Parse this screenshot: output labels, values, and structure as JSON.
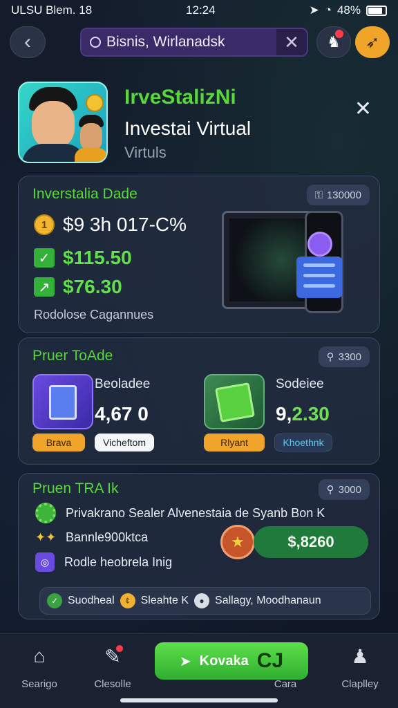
{
  "status_bar": {
    "carrier": "ULSU Blem. 18",
    "time": "12:24",
    "battery": "48%"
  },
  "topbar": {
    "search_tag": "Bisnis, Wirlanadsk",
    "clear_symbol": "✕",
    "back_symbol": "‹"
  },
  "hero": {
    "title": "IrveStalizNi",
    "subtitle": "Investai Virtual",
    "caption": "Virtuls"
  },
  "card1": {
    "title": "Inverstalia Dade",
    "pill": "130000",
    "row_coin_value": "$9 3h 017-C%",
    "row_green1_prefix": "$",
    "row_green1_value": "$115.50",
    "row_green2_value": "$76.30",
    "footer": "Rodolose Cagannues"
  },
  "card2": {
    "title": "Pruer ToAde",
    "pill": "3300",
    "left": {
      "label": "Beoladee",
      "value": "4,67 0",
      "chip1": "Brava",
      "chip2": "Vicheftom"
    },
    "right": {
      "label": "Sodeiee",
      "value_white": "9,",
      "value_green": "2.30",
      "chip1": "Rlyant",
      "chip2": "Khoethnk"
    }
  },
  "card3": {
    "title": "Pruen TRA Ik",
    "pill": "3000",
    "line1": "Privakrano Sealer Alvenestaia de Syanb Bon K",
    "line2": "Bannle900ktca",
    "line3": "Rodle heobrela Inig",
    "amount": "$,8260",
    "strip": {
      "item1": "Suodheal",
      "item2": "Sleahte K",
      "item3": "Sallagy, Moodhanaun"
    }
  },
  "nav": {
    "item1": "Searigo",
    "item2": "Clesolle",
    "cta_label": "Kovaka",
    "cta_big": "CJ",
    "cta_caption": "Cara",
    "item4": "Claplley"
  },
  "colors": {
    "accent_green": "#58d83a",
    "bg": "#121a2a",
    "purple": "#4b3a82",
    "orange": "#f0a52a"
  }
}
